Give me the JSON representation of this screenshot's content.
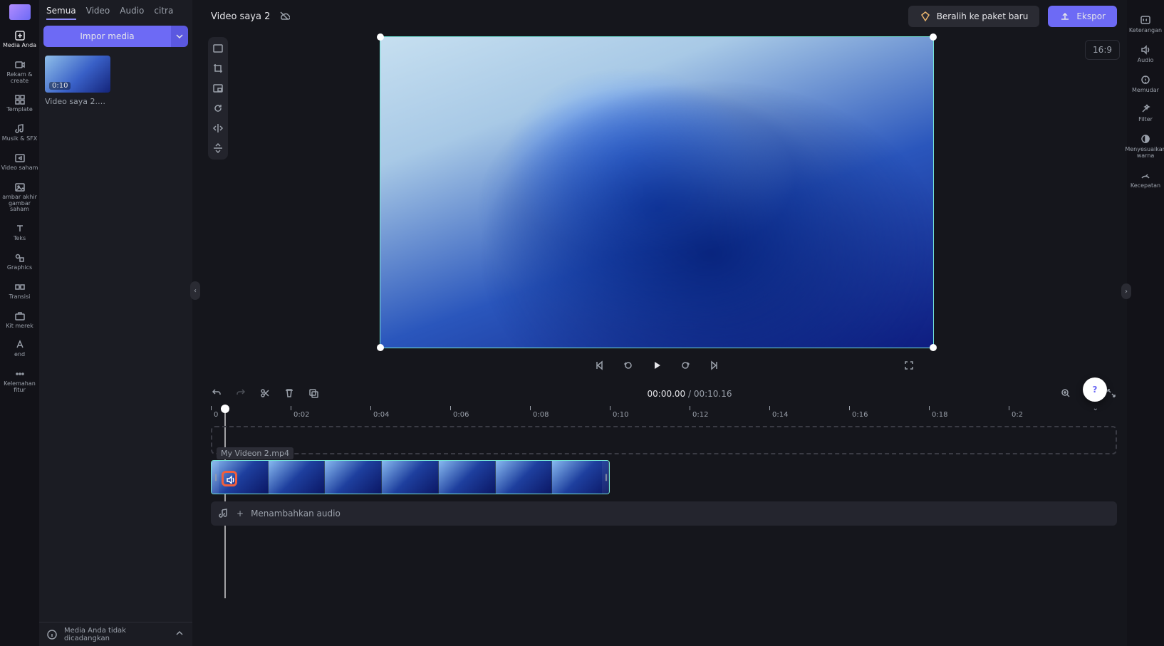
{
  "topbar": {
    "project_title": "Video saya 2",
    "upgrade_label": "Beralih ke paket baru",
    "export_label": "Ekspor",
    "aspect_ratio": "16:9"
  },
  "tabs": {
    "all": "Semua",
    "video": "Video",
    "audio": "Audio",
    "image": "citra"
  },
  "media": {
    "import_label": "Impor media",
    "item_name": "Video saya 2.m… v",
    "item_duration": "0:10",
    "backup_note": "Media Anda tidak dicadangkan"
  },
  "left_rail": {
    "media": "Media Anda",
    "record": "Rekam &amp; create",
    "template": "Template",
    "music": "Musik &amp; SFX",
    "stock_video": "Video saham",
    "stock_image": "ambar akhir gambar saham",
    "text": "Teks",
    "graphics": "Graphics",
    "transition": "Transisi",
    "brand": "Kit merek",
    "end": "end",
    "more": "Kelemahan fitur"
  },
  "right_rail": {
    "caption": "Keterangan",
    "audio": "Audio",
    "fade": "Memudar",
    "filter": "Filter",
    "color": "Menyesuaikan warna",
    "speed": "Kecepatan"
  },
  "timeline": {
    "current": "00:00.00",
    "total": "00:10.16",
    "separator": " / ",
    "ticks": [
      "0",
      "0:02",
      "0:04",
      "0:06",
      "0:08",
      "0:10",
      "0:12",
      "0:14",
      "0:16",
      "0:18",
      "0:2"
    ],
    "clip_name": "My Videon 2.mp4",
    "add_audio": "Menambahkan audio"
  }
}
